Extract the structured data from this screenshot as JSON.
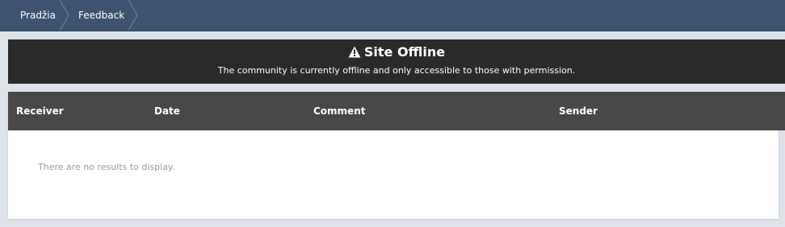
{
  "breadcrumb": {
    "items": [
      {
        "label": "Pradžia"
      },
      {
        "label": "Feedback"
      }
    ]
  },
  "offline_notice": {
    "icon": "warning-icon",
    "title": "Site Offline",
    "message": "The community is currently offline and only accessible to those with permission."
  },
  "table": {
    "columns": [
      "Receiver",
      "Date",
      "Comment",
      "Sender"
    ],
    "empty_message": "There are no results to display."
  },
  "colors": {
    "breadcrumb_bg": "#3c5470",
    "offline_bg": "#2a2a2a",
    "table_header_bg": "#4a4846",
    "page_bg": "#dde3e9"
  }
}
